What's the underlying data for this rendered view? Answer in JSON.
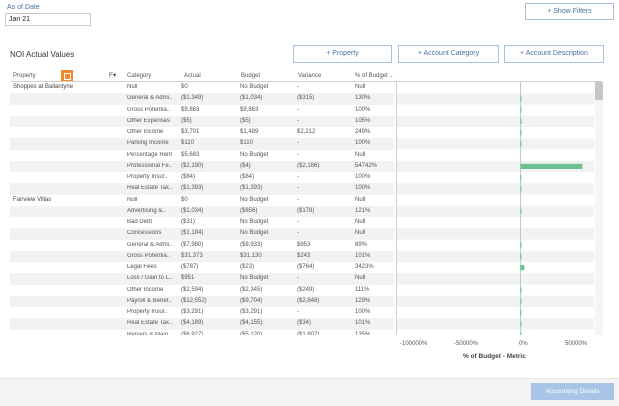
{
  "filters": {
    "as_of_label": "As of Date",
    "as_of_value": "Jan 21",
    "show_filters_label": "+ Show Filters"
  },
  "report": {
    "title": "NOI Actual Values",
    "btn_property": "+ Property",
    "btn_account_category": "+ Account Category",
    "btn_account_description": "+ Account Description"
  },
  "columns": {
    "property": "Property",
    "category": "Category",
    "actual": "Actual",
    "budget": "Budget",
    "variance": "Variance",
    "pct_budget": "% of Budget .."
  },
  "rows": [
    {
      "property": "Shoppes at Ballantyne",
      "category": "Null",
      "actual": "$0",
      "budget": "No Budget",
      "variance": "-",
      "pct": "Null",
      "pct_value": null
    },
    {
      "property": "",
      "category": "General & Admi..",
      "actual": "($1,349)",
      "budget": "($1,034)",
      "variance": "($315)",
      "pct": "130%",
      "pct_value": 130
    },
    {
      "property": "",
      "category": "Gross Potentia..",
      "actual": "$9,863",
      "budget": "$9,863",
      "variance": "-",
      "pct": "100%",
      "pct_value": 100
    },
    {
      "property": "",
      "category": "Other Expenses",
      "actual": "($5)",
      "budget": "($5)",
      "variance": "-",
      "pct": "105%",
      "pct_value": 105
    },
    {
      "property": "",
      "category": "Other Income",
      "actual": "$3,701",
      "budget": "$1,489",
      "variance": "$2,212",
      "pct": "249%",
      "pct_value": 249
    },
    {
      "property": "",
      "category": "Parking Income",
      "actual": "$110",
      "budget": "$110",
      "variance": "-",
      "pct": "100%",
      "pct_value": 100
    },
    {
      "property": "",
      "category": "Percentage Rent",
      "actual": "$5,683",
      "budget": "No Budget",
      "variance": "-",
      "pct": "Null",
      "pct_value": null
    },
    {
      "property": "",
      "category": "Professional Fe..",
      "actual": "($2,190)",
      "budget": "($4)",
      "variance": "($2,186)",
      "pct": "54742%",
      "pct_value": 54742
    },
    {
      "property": "",
      "category": "Property Insur..",
      "actual": "($84)",
      "budget": "($84)",
      "variance": "-",
      "pct": "100%",
      "pct_value": 100
    },
    {
      "property": "",
      "category": "Real Estate Tax..",
      "actual": "($1,393)",
      "budget": "($1,393)",
      "variance": "-",
      "pct": "100%",
      "pct_value": 100
    },
    {
      "property": "Fairview Villas",
      "category": "Null",
      "actual": "$0",
      "budget": "No Budget",
      "variance": "-",
      "pct": "Null",
      "pct_value": null
    },
    {
      "property": "",
      "category": "Advertising &..",
      "actual": "($1,034)",
      "budget": "($856)",
      "variance": "($178)",
      "pct": "121%",
      "pct_value": 121
    },
    {
      "property": "",
      "category": "Bad Debt",
      "actual": "($31)",
      "budget": "No Budget",
      "variance": "-",
      "pct": "Null",
      "pct_value": null
    },
    {
      "property": "",
      "category": "Concessions",
      "actual": "($1,184)",
      "budget": "No Budget",
      "variance": "-",
      "pct": "Null",
      "pct_value": null
    },
    {
      "property": "",
      "category": "General & Admi..",
      "actual": "($7,980)",
      "budget": "($8,933)",
      "variance": "$953",
      "pct": "89%",
      "pct_value": 89
    },
    {
      "property": "",
      "category": "Gross Potentia..",
      "actual": "$31,373",
      "budget": "$31,130",
      "variance": "$243",
      "pct": "101%",
      "pct_value": 101
    },
    {
      "property": "",
      "category": "Legal Fees",
      "actual": "($787)",
      "budget": "($23)",
      "variance": "($764)",
      "pct": "3423%",
      "pct_value": 3423
    },
    {
      "property": "",
      "category": "Loss / Gain to L..",
      "actual": "$951",
      "budget": "No Budget",
      "variance": "-",
      "pct": "Null",
      "pct_value": null
    },
    {
      "property": "",
      "category": "Other Income",
      "actual": "($2,594)",
      "budget": "($2,345)",
      "variance": "($249)",
      "pct": "111%",
      "pct_value": 111
    },
    {
      "property": "",
      "category": "Payroll & Benef..",
      "actual": "($12,552)",
      "budget": "($9,704)",
      "variance": "($2,848)",
      "pct": "129%",
      "pct_value": 129
    },
    {
      "property": "",
      "category": "Property Insur..",
      "actual": "($3,291)",
      "budget": "($3,291)",
      "variance": "-",
      "pct": "100%",
      "pct_value": 100
    },
    {
      "property": "",
      "category": "Real Estate Tax..",
      "actual": "($4,189)",
      "budget": "($4,155)",
      "variance": "($34)",
      "pct": "101%",
      "pct_value": 101
    },
    {
      "property": "",
      "category": "Repairs & Main..",
      "actual": "($6,927)",
      "budget": "($5,120)",
      "variance": "($1,807)",
      "pct": "135%",
      "pct_value": 135
    }
  ],
  "chart": {
    "axis_title": "% of Budget - Metric",
    "ticks": [
      "-100000%",
      "-50000%",
      "0%",
      "50000%"
    ],
    "bar_color": "#6cc091",
    "zero_line_color": "#a8d5b9"
  },
  "chart_data": {
    "type": "bar",
    "orientation": "horizontal",
    "xlim": [
      -110000,
      65000
    ],
    "xticks": [
      -100000,
      -50000,
      0,
      50000
    ],
    "xlabel": "% of Budget - Metric",
    "values": [
      null,
      130,
      100,
      105,
      249,
      100,
      null,
      54742,
      100,
      100,
      null,
      121,
      null,
      null,
      89,
      101,
      3423,
      null,
      111,
      129,
      100,
      101,
      135
    ]
  },
  "footer": {
    "accounting_details_label": "Accounting Details"
  }
}
